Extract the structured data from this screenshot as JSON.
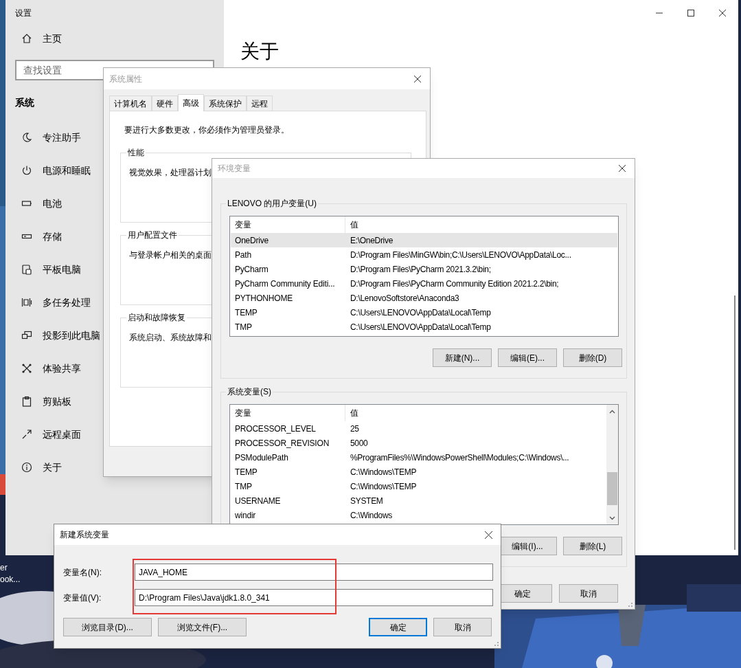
{
  "desktop": {
    "icon_labels": [
      "er",
      "ook..."
    ]
  },
  "settings": {
    "title": "设置",
    "active": true,
    "home": "主页",
    "search": {
      "placeholder": "查找设置"
    },
    "section": "系统",
    "heading": "关于",
    "items": [
      {
        "label": "专注助手"
      },
      {
        "label": "电源和睡眠"
      },
      {
        "label": "电池"
      },
      {
        "label": "存储"
      },
      {
        "label": "平板电脑"
      },
      {
        "label": "多任务处理"
      },
      {
        "label": "投影到此电脑"
      },
      {
        "label": "体验共享"
      },
      {
        "label": "剪贴板"
      },
      {
        "label": "远程桌面"
      },
      {
        "label": "关于"
      }
    ]
  },
  "system_properties": {
    "title": "系统属性",
    "active": false,
    "tabs": [
      {
        "label": "计算机名",
        "selected": false
      },
      {
        "label": "硬件",
        "selected": false
      },
      {
        "label": "高级",
        "selected": true
      },
      {
        "label": "系统保护",
        "selected": false
      },
      {
        "label": "远程",
        "selected": false
      }
    ],
    "notice": "要进行大多数更改，你必须作为管理员登录。",
    "groups": [
      {
        "title": "性能",
        "text": "视觉效果，处理器计划"
      },
      {
        "title": "用户配置文件",
        "text": "与登录帐户相关的桌面"
      },
      {
        "title": "启动和故障恢复",
        "text": "系统启动、系统故障和"
      }
    ]
  },
  "environment_variables": {
    "title": "环境变量",
    "active": false,
    "user_vars": {
      "title": "LENOVO 的用户变量(U)",
      "columns": [
        "变量",
        "值"
      ],
      "rows": [
        {
          "name": "OneDrive",
          "value": "E:\\OneDrive",
          "selected": true
        },
        {
          "name": "Path",
          "value": "D:\\Program Files\\MinGW\\bin;C:\\Users\\LENOVO\\AppData\\Loc...",
          "selected": false
        },
        {
          "name": "PyCharm",
          "value": "D:\\Program Files\\PyCharm 2021.3.2\\bin;",
          "selected": false
        },
        {
          "name": "PyCharm Community Editi...",
          "value": "D:\\Program Files\\PyCharm Community Edition 2021.2.2\\bin;",
          "selected": false
        },
        {
          "name": "PYTHONHOME",
          "value": "D:\\LenovoSoftstore\\Anaconda3",
          "selected": false
        },
        {
          "name": "TEMP",
          "value": "C:\\Users\\LENOVO\\AppData\\Local\\Temp",
          "selected": false
        },
        {
          "name": "TMP",
          "value": "C:\\Users\\LENOVO\\AppData\\Local\\Temp",
          "selected": false
        }
      ],
      "buttons": [
        "新建(N)...",
        "编辑(E)...",
        "删除(D)"
      ]
    },
    "system_vars": {
      "title": "系统变量(S)",
      "columns": [
        "变量",
        "值"
      ],
      "rows": [
        {
          "name": "PROCESSOR_LEVEL",
          "value": "25",
          "selected": false
        },
        {
          "name": "PROCESSOR_REVISION",
          "value": "5000",
          "selected": false
        },
        {
          "name": "PSModulePath",
          "value": "%ProgramFiles%\\WindowsPowerShell\\Modules;C:\\Windows\\...",
          "selected": false
        },
        {
          "name": "TEMP",
          "value": "C:\\Windows\\TEMP",
          "selected": false
        },
        {
          "name": "TMP",
          "value": "C:\\Windows\\TEMP",
          "selected": false
        },
        {
          "name": "USERNAME",
          "value": "SYSTEM",
          "selected": false
        },
        {
          "name": "windir",
          "value": "C:\\Windows",
          "selected": false
        }
      ],
      "buttons": [
        "编辑(I)...",
        "删除(L)"
      ]
    },
    "buttons": [
      "确定",
      "取消"
    ]
  },
  "new_variable": {
    "title": "新建系统变量",
    "active": true,
    "fields": [
      {
        "label": "变量名(N):",
        "value": "JAVA_HOME"
      },
      {
        "label": "变量值(V):",
        "value": "D:\\Program Files\\Java\\jdk1.8.0_341"
      }
    ],
    "buttons": [
      {
        "label": "浏览目录(D)...",
        "focused": false
      },
      {
        "label": "浏览文件(F)...",
        "focused": false
      },
      {
        "label": "确定",
        "focused": true
      },
      {
        "label": "取消",
        "focused": false
      }
    ]
  }
}
